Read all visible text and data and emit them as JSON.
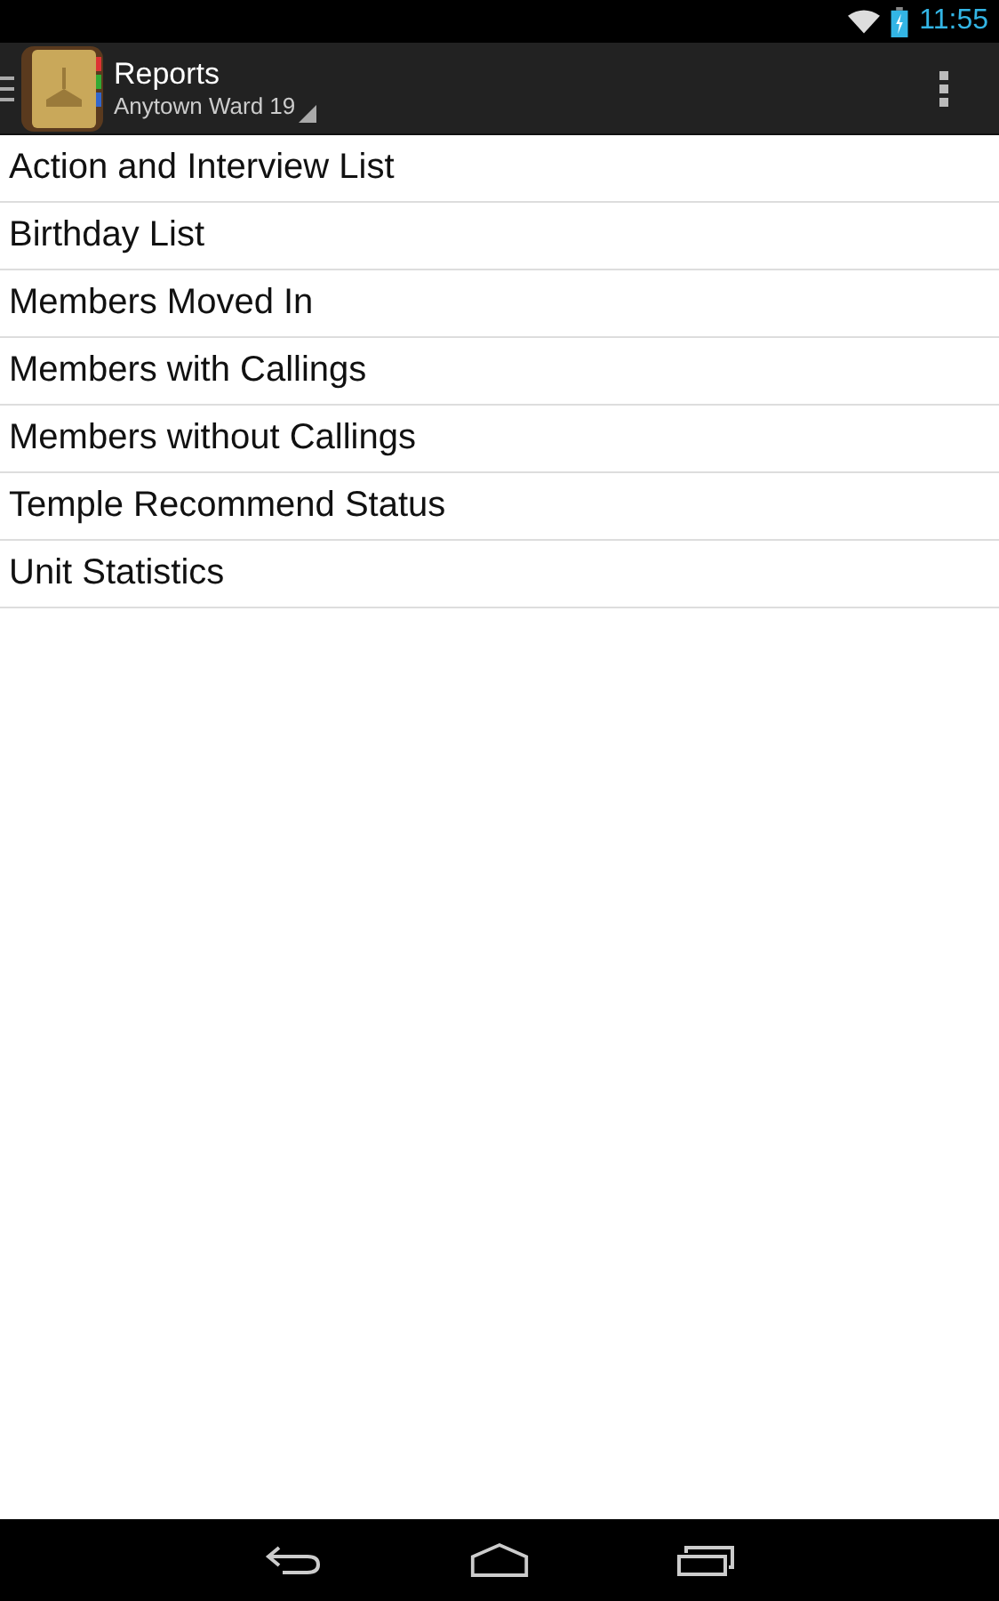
{
  "status_bar": {
    "time": "11:55"
  },
  "action_bar": {
    "title": "Reports",
    "subtitle": "Anytown Ward 19"
  },
  "reports": [
    {
      "label": "Action and Interview List"
    },
    {
      "label": "Birthday List"
    },
    {
      "label": "Members Moved In"
    },
    {
      "label": "Members with Callings"
    },
    {
      "label": "Members without Callings"
    },
    {
      "label": "Temple Recommend Status"
    },
    {
      "label": "Unit Statistics"
    }
  ]
}
